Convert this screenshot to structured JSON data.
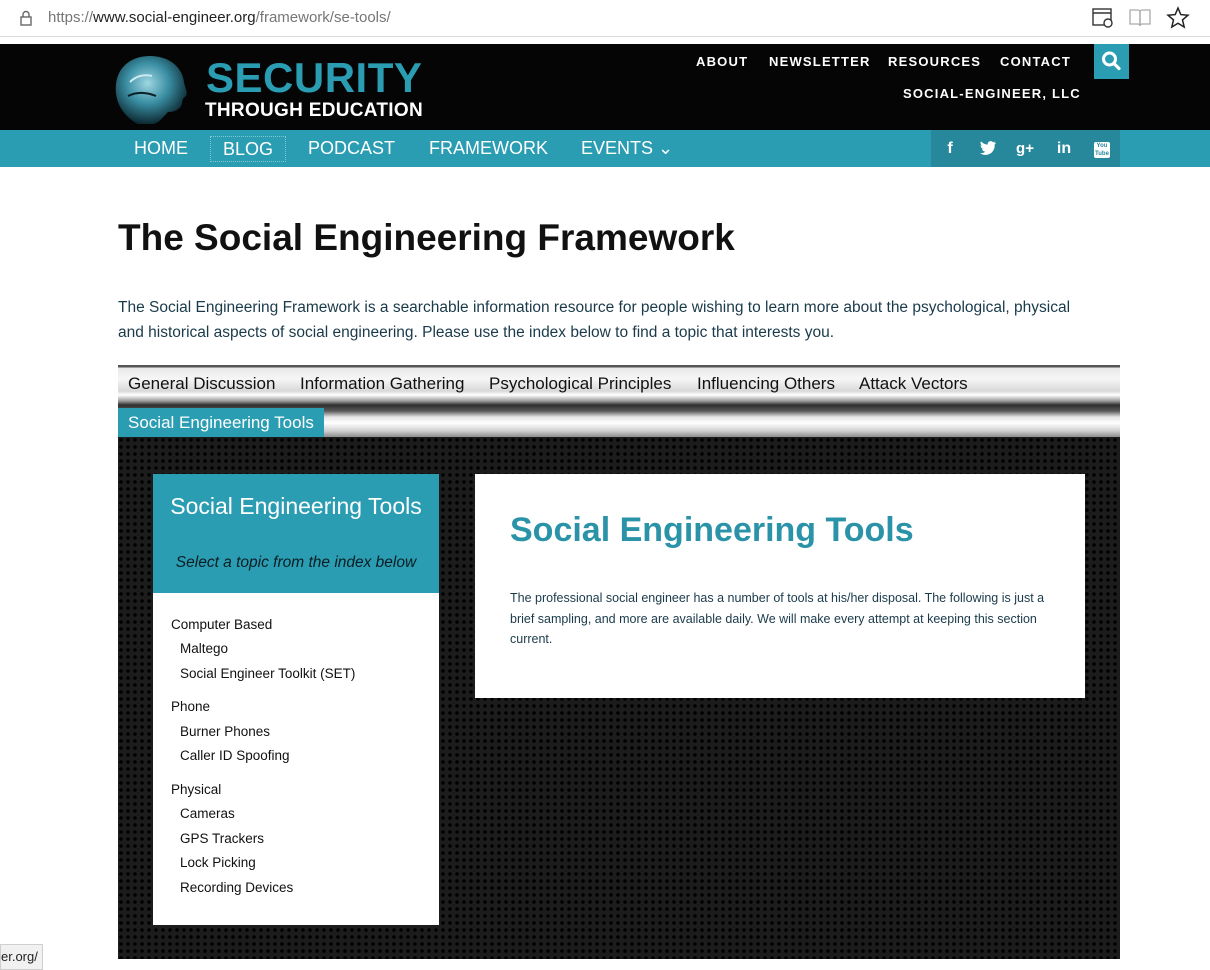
{
  "browser": {
    "url_scheme": "https://",
    "url_host": "www.social-engineer.org",
    "url_path": "/framework/se-tools/",
    "icons": [
      "lock-icon",
      "reading-view-icon",
      "reading-list-icon",
      "favorite-star-icon"
    ]
  },
  "header": {
    "logo_title": "SECURITY",
    "logo_subtitle": "THROUGH EDUCATION",
    "top_links": [
      "ABOUT",
      "NEWSLETTER",
      "RESOURCES",
      "CONTACT"
    ],
    "company_link": "SOCIAL-ENGINEER, LLC"
  },
  "nav": {
    "items": [
      "HOME",
      "BLOG",
      "PODCAST",
      "FRAMEWORK",
      "EVENTS ⌄"
    ],
    "social": [
      "f",
      "twitter",
      "g+",
      "in",
      "You Tube"
    ]
  },
  "page": {
    "title": "The Social Engineering Framework",
    "intro": "The Social Engineering Framework is a searchable information resource for people wishing to learn more about the psychological, physical and historical aspects of social engineering. Please use the index below to find a topic that interests you."
  },
  "tabs": {
    "items": [
      "General Discussion",
      "Information Gathering",
      "Psychological Principles",
      "Influencing Others",
      "Attack Vectors"
    ],
    "active": "Social Engineering Tools"
  },
  "sidebar": {
    "title": "Social Engineering Tools",
    "subtitle": "Select a topic from the index below",
    "groups": [
      {
        "heading": "Computer Based",
        "items": [
          "Maltego",
          "Social Engineer Toolkit (SET)"
        ]
      },
      {
        "heading": "Phone",
        "items": [
          "Burner Phones",
          "Caller ID Spoofing"
        ]
      },
      {
        "heading": "Physical",
        "items": [
          "Cameras",
          "GPS Trackers",
          "Lock Picking",
          "Recording Devices"
        ]
      }
    ]
  },
  "content": {
    "title": "Social Engineering Tools",
    "text": "The professional social engineer has a number of tools at his/her disposal. The following is just a brief sampling, and more are available daily. We will make every attempt at keeping this section current."
  },
  "status": {
    "text": "er.org/"
  },
  "colors": {
    "accent": "#2a9db3",
    "header_bg": "#050505",
    "panel_bg": "#1c1c1c"
  }
}
